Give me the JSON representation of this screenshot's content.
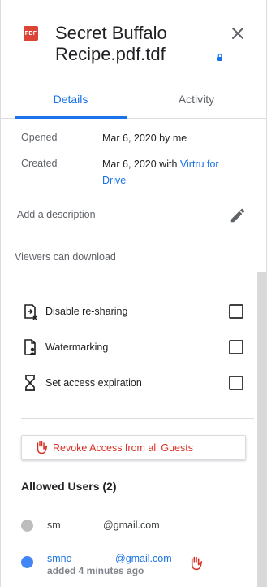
{
  "header": {
    "file_badge": "PDF",
    "title": "Secret Buffalo Recipe.pdf.tdf",
    "icons": {
      "file": "pdf-file-icon",
      "lock": "lock-icon",
      "close": "close-icon"
    }
  },
  "tabs": [
    {
      "label": "Details",
      "active": true
    },
    {
      "label": "Activity",
      "active": false
    }
  ],
  "details": {
    "opened": {
      "label": "Opened",
      "value": "Mar 6, 2020 by me"
    },
    "created": {
      "label": "Created",
      "value_prefix": "Mar 6, 2020 with ",
      "link": "Virtru for Drive"
    }
  },
  "description": {
    "placeholder": "Add a description",
    "icon": "edit-pencil-icon"
  },
  "viewers_text": "Viewers can download",
  "options": [
    {
      "label": "Disable re-sharing",
      "icon": "reshare-disabled-icon",
      "checked": false
    },
    {
      "label": "Watermarking",
      "icon": "watermark-file-icon",
      "checked": false
    },
    {
      "label": "Set access expiration",
      "icon": "hourglass-icon",
      "checked": false
    }
  ],
  "revoke_all": {
    "label": "Revoke Access from all Guests",
    "icon": "hand-stop-icon"
  },
  "allowed_users": {
    "heading": "Allowed Users (2)",
    "users": [
      {
        "name": "sm",
        "email": "@gmail.com",
        "dot_color": "#bdbdbd",
        "color": "#3c4043"
      },
      {
        "name": "smno",
        "email": "@gmail.com",
        "added": "added 4 minutes ago",
        "dot_color": "#4285f4",
        "color": "#1a73e8"
      }
    ]
  },
  "colors": {
    "accent": "#1a73e8",
    "danger": "#d93025",
    "pdf_red": "#db4437"
  }
}
